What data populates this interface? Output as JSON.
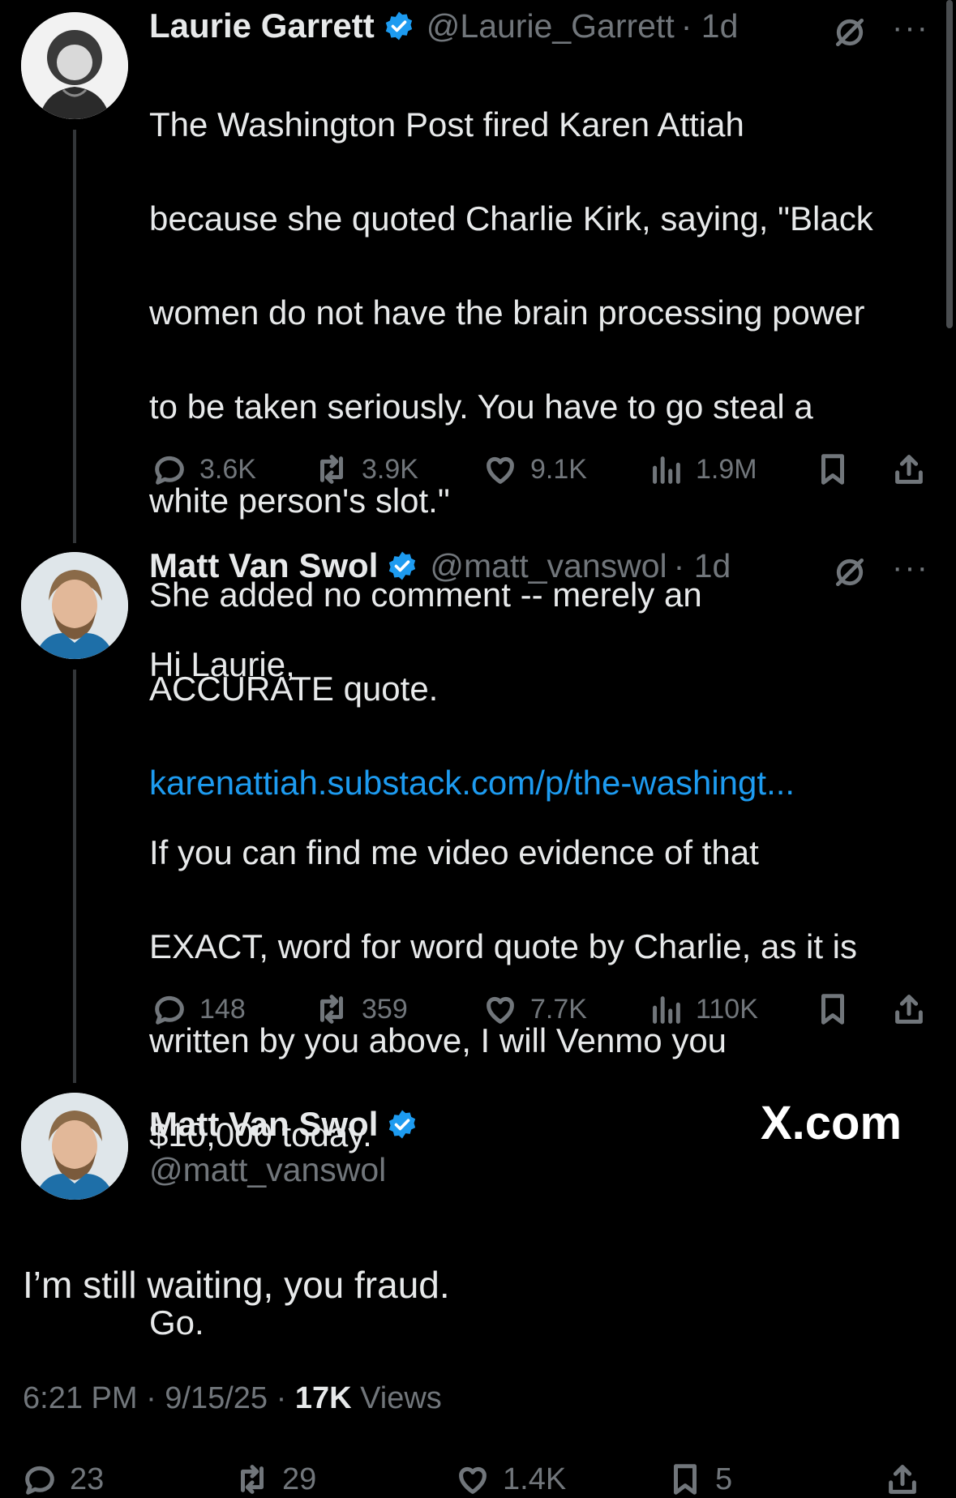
{
  "scrollbar": true,
  "colors": {
    "background": "#000000",
    "text": "#e7e9ea",
    "muted": "#71767b",
    "link": "#1d9bf0",
    "verified": "#1d9bf0"
  },
  "tweet1": {
    "name": "Laurie Garrett",
    "handle": "@Laurie_Garrett",
    "time": "· 1d",
    "text_lines": [
      "The Washington Post fired Karen Attiah",
      "because she quoted Charlie Kirk, saying, \"Black",
      "women do not have the brain processing power",
      "to be taken seriously. You have to go steal a",
      "white person's slot.\"",
      "She added no comment -- merely an",
      "ACCURATE quote."
    ],
    "link": "karenattiah.substack.com/p/the-washingt...",
    "replies": "3.6K",
    "reposts": "3.9K",
    "likes": "9.1K",
    "views": "1.9M",
    "avatar_icon": "profile-photo-woman-icon",
    "grok_icon": "grok-slash-icon",
    "more": "···"
  },
  "tweet2": {
    "name": "Matt Van Swol",
    "handle": "@matt_vanswol",
    "time": "· 1d",
    "text_lines": [
      "Hi Laurie,",
      "",
      "If you can find me video evidence of that",
      "EXACT, word for word quote by Charlie, as it is",
      "written by you above, I will Venmo you",
      "$10,000 today.",
      "",
      "Go."
    ],
    "replies": "148",
    "reposts": "359",
    "likes": "7.7K",
    "views": "110K",
    "avatar_icon": "profile-photo-man-icon",
    "more": "···"
  },
  "tweet3": {
    "name": "Matt Van Swol",
    "handle": "@matt_vanswol",
    "watermark": "X.com",
    "text": "I’m still waiting, you fraud.",
    "timestamp": "6:21 PM · 9/15/25 · ",
    "views_count": "17K",
    "views_label": "Views",
    "replies": "23",
    "reposts": "29",
    "likes": "1.4K",
    "bookmarks": "5"
  }
}
